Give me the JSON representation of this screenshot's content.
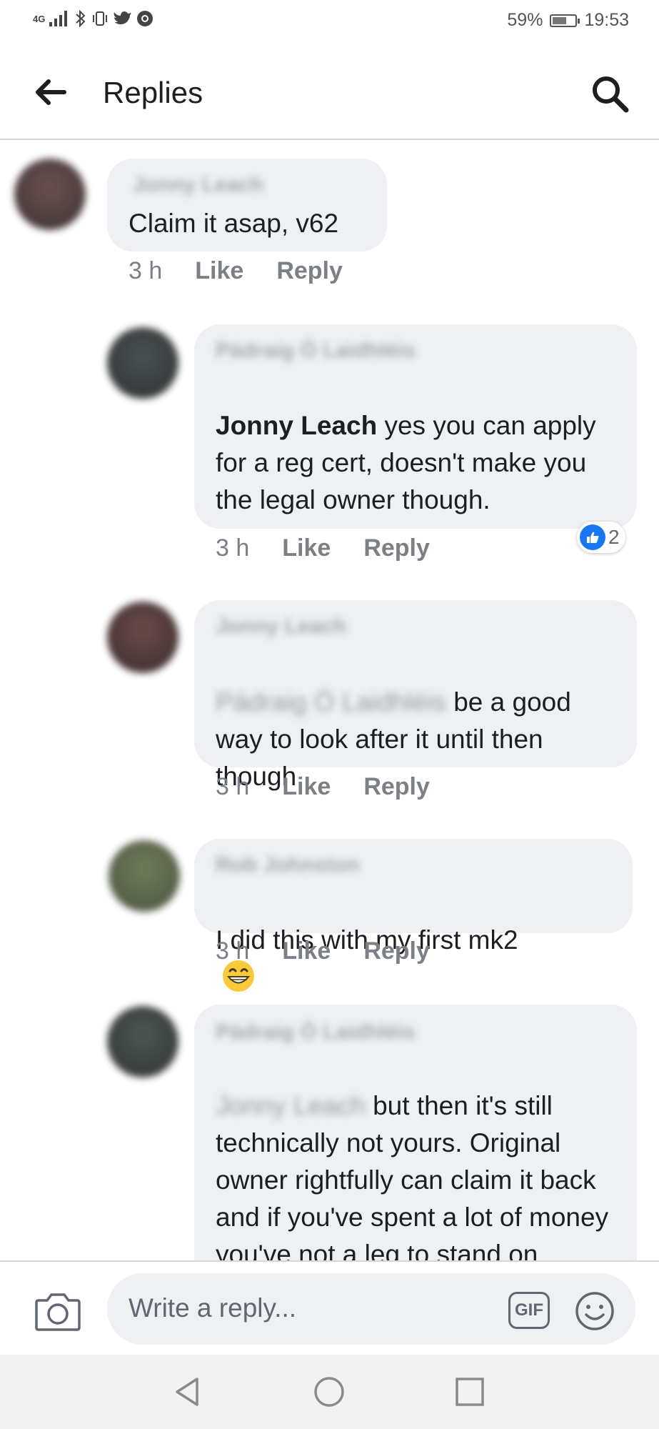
{
  "status_bar": {
    "network": "4G",
    "battery": "59%",
    "time": "19:53",
    "icons": [
      "signal-icon",
      "bluetooth-icon",
      "vibrate-icon",
      "twitter-icon",
      "chrome-icon"
    ]
  },
  "header": {
    "title": "Replies",
    "back_icon": "arrow-left-icon",
    "search_icon": "search-icon"
  },
  "comments": [
    {
      "author": "Jonny Leach",
      "text": "Claim it asap, v62",
      "time": "3 h",
      "like": "Like",
      "reply": "Reply"
    },
    {
      "author": "Pádraig Ó Laidhléis",
      "mention": "Jonny Leach",
      "text": " yes you can apply for a reg cert, doesn't make you the legal owner though.",
      "time": "3 h",
      "like": "Like",
      "reply": "Reply",
      "reaction_count": "2"
    },
    {
      "author": "Jonny Leach",
      "blurred_prefix": "Pádraig Ó Laidhléis",
      "text": " be a good way to look after it until then though",
      "time": "3 h",
      "like": "Like",
      "reply": "Reply"
    },
    {
      "author": "Rob Johnston",
      "text": "I did this with my first mk2",
      "emoji": "grinning-face-icon",
      "time": "3 h",
      "like": "Like",
      "reply": "Reply"
    },
    {
      "author": "Pádraig Ó Laidhléis",
      "mention": "Jonny Leach",
      "text": " but then it's still technically not yours. Original owner rightfully can claim it back and if you've spent a lot of money you've not a leg to stand on."
    }
  ],
  "composer": {
    "placeholder": "Write a reply...",
    "gif_label": "GIF",
    "camera_icon": "camera-icon",
    "emoji_icon": "smiley-icon"
  },
  "nav": {
    "icons": [
      "back-triangle-icon",
      "home-circle-icon",
      "recents-square-icon"
    ]
  },
  "colors": {
    "bubble": "#eef0f3",
    "like_blue": "#1877f2",
    "meta_gray": "#7b7f86"
  }
}
